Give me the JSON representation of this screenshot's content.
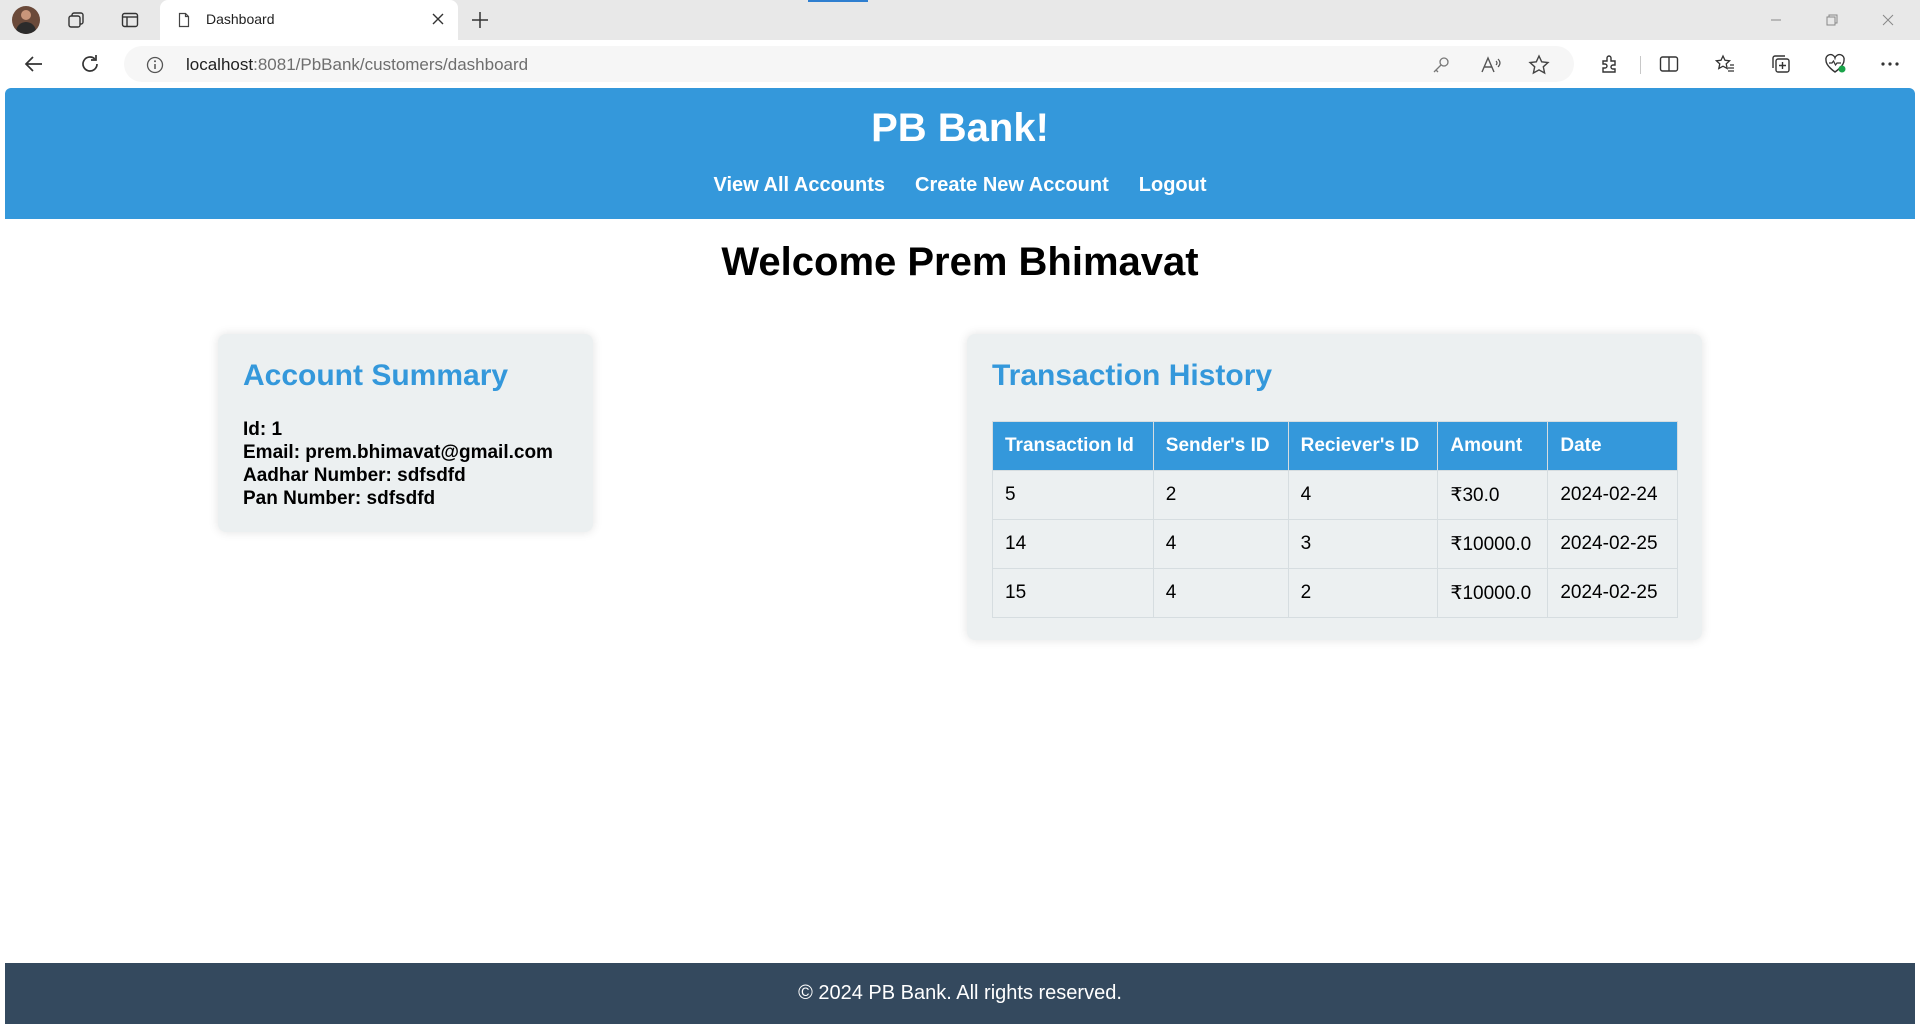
{
  "browser": {
    "tab_title": "Dashboard",
    "url_host": "localhost",
    "url_rest": ":8081/PbBank/customers/dashboard"
  },
  "site": {
    "title": "PB Bank!",
    "nav": [
      "View All Accounts",
      "Create New Account",
      "Logout"
    ]
  },
  "welcome": "Welcome Prem Bhimavat",
  "account_summary": {
    "heading": "Account Summary",
    "id": "Id: 1",
    "email": "Email: prem.bhimavat@gmail.com",
    "aadhar": "Aadhar Number: sdfsdfd",
    "pan": "Pan Number: sdfsdfd"
  },
  "transactions": {
    "heading": "Transaction History",
    "columns": [
      "Transaction Id",
      "Sender's ID",
      "Reciever's ID",
      "Amount",
      "Date"
    ],
    "rows": [
      [
        "5",
        "2",
        "4",
        "₹30.0",
        "2024-02-24"
      ],
      [
        "14",
        "4",
        "3",
        "₹10000.0",
        "2024-02-25"
      ],
      [
        "15",
        "4",
        "2",
        "₹10000.0",
        "2024-02-25"
      ]
    ]
  },
  "footer": "© 2024 PB Bank. All rights reserved.",
  "colors": {
    "header_blue": "#3498db",
    "card_bg": "#ecf0f1",
    "footer_bg": "#34495e"
  }
}
